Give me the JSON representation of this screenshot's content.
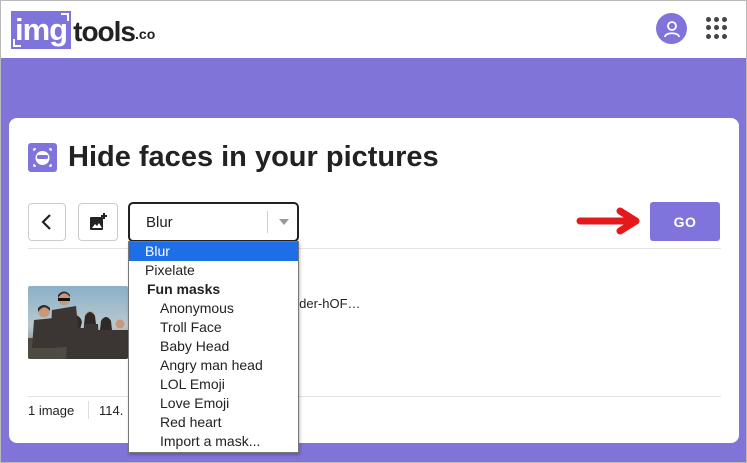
{
  "header": {
    "logo": {
      "img": "img",
      "tools": "tools",
      ".co": ".co"
    },
    "avatar_icon": "user-icon",
    "apps_icon": "grid-icon"
  },
  "page": {
    "title": "Hide faces in your pictures",
    "title_icon": "face-mask-icon"
  },
  "toolbar": {
    "back_icon": "chevron-left-icon",
    "add_image_icon": "add-image-icon",
    "select_value": "Blur",
    "go_label": "GO",
    "accent": "#7e74dc",
    "arrow_color": "#e4191c"
  },
  "dropdown": {
    "options": [
      {
        "label": "Blur",
        "kind": "option",
        "selected": true
      },
      {
        "label": "Pixelate",
        "kind": "option"
      },
      {
        "label": "Fun masks",
        "kind": "group"
      },
      {
        "label": "Anonymous",
        "kind": "sub"
      },
      {
        "label": "Troll Face",
        "kind": "sub"
      },
      {
        "label": "Baby Head",
        "kind": "sub"
      },
      {
        "label": "Angry man head",
        "kind": "sub"
      },
      {
        "label": "LOL Emoji",
        "kind": "sub"
      },
      {
        "label": "Love Emoji",
        "kind": "sub"
      },
      {
        "label": "Red heart",
        "kind": "sub"
      },
      {
        "label": "Import a mask...",
        "kind": "sub"
      }
    ],
    "selected_color": "#1e6ee8"
  },
  "file_list": {
    "filename": "older-hOF…"
  },
  "footer": {
    "count": "1 image",
    "size": "114."
  }
}
